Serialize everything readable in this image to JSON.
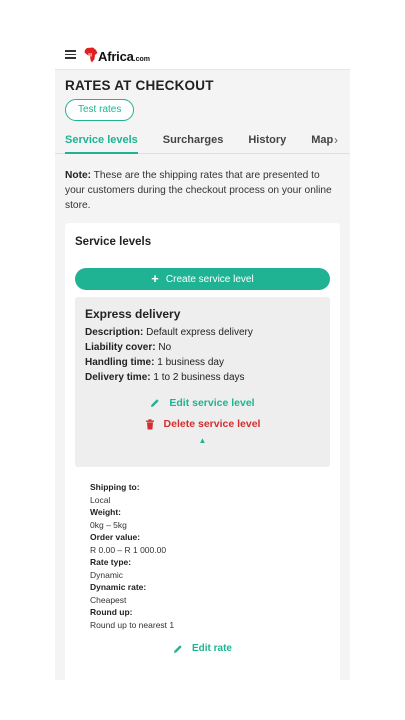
{
  "brand": {
    "logo_main": "Africa",
    "logo_suffix": ".com",
    "accent": "#1fb393",
    "danger": "#d32f2f"
  },
  "header": {
    "title": "RATES AT CHECKOUT",
    "test_rates": "Test rates"
  },
  "tabs": [
    {
      "label": "Service levels",
      "active": true
    },
    {
      "label": "Surcharges",
      "active": false
    },
    {
      "label": "History",
      "active": false
    },
    {
      "label": "Map",
      "active": false
    }
  ],
  "note": {
    "label": "Note:",
    "text": " These are the shipping rates that are presented to your customers during the checkout process on your online store."
  },
  "card": {
    "title": "Service levels",
    "create_button": "Create service level"
  },
  "service": {
    "title": "Express delivery",
    "description_label": "Description:",
    "description": " Default express delivery",
    "liability_label": "Liability cover:",
    "liability": " No",
    "handling_label": "Handling time:",
    "handling": " 1 business day",
    "delivery_label": "Delivery time:",
    "delivery": " 1 to 2 business days",
    "edit_label": "Edit service level",
    "delete_label": "Delete service level"
  },
  "rate": {
    "fields": [
      {
        "label": "Shipping to:",
        "value": "Local"
      },
      {
        "label": "Weight:",
        "value": "0kg – 5kg"
      },
      {
        "label": "Order value:",
        "value": "R 0.00 – R 1 000.00"
      },
      {
        "label": "Rate type:",
        "value": "Dynamic"
      },
      {
        "label": "Dynamic rate:",
        "value": "Cheapest"
      },
      {
        "label": "Round up:",
        "value": "Round up to nearest 1"
      }
    ],
    "edit_label": "Edit rate"
  }
}
